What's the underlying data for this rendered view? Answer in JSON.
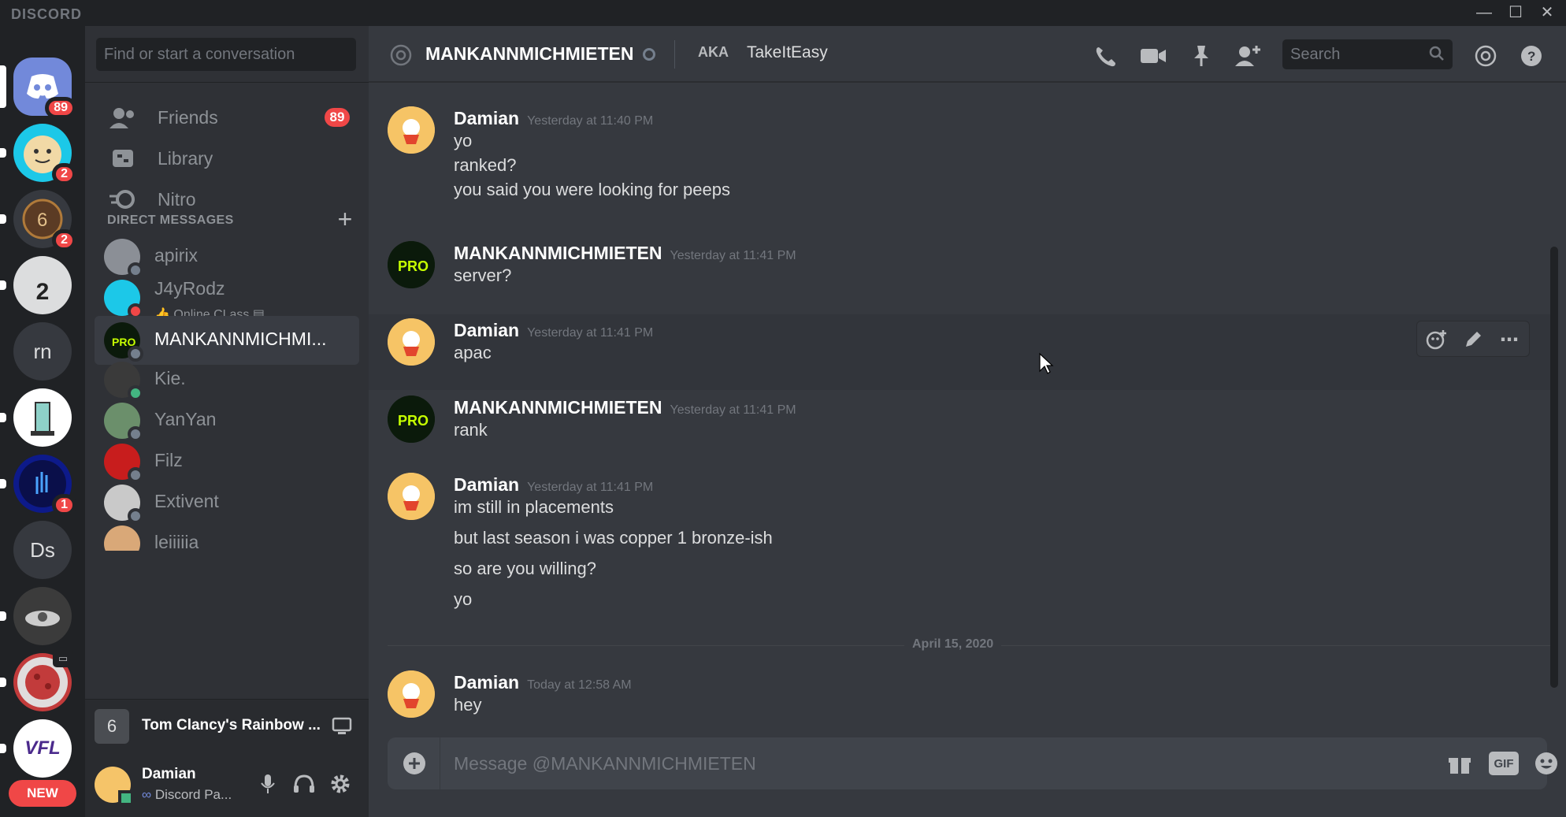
{
  "app": {
    "brand": "DISCORD",
    "window_controls": {
      "minimize": "—",
      "maximize": "☐",
      "close": "✕"
    }
  },
  "servers": [
    {
      "name": "home",
      "badge": "89",
      "color": "#7289da"
    },
    {
      "name": "server-smiley",
      "badge": "2",
      "color": "#1cc8e8"
    },
    {
      "name": "server-rainbow",
      "badge": "2",
      "color": "#5b3b24"
    },
    {
      "name": "server-y2",
      "label": "2",
      "color": "#dcddde"
    },
    {
      "name": "server-rn",
      "label": "rn",
      "color": "#36393f"
    },
    {
      "name": "server-cartoon",
      "color": "#ffffff"
    },
    {
      "name": "server-blue",
      "badge": "1",
      "color": "#0d1a8a"
    },
    {
      "name": "server-ds",
      "label": "Ds",
      "color": "#36393f"
    },
    {
      "name": "server-car",
      "color": "#3b3b3b"
    },
    {
      "name": "server-virus",
      "color": "#c23b3b"
    },
    {
      "name": "server-vfl",
      "label": "VFL",
      "color": "#4b2a8c"
    }
  ],
  "rail_new": "NEW",
  "sidebar": {
    "search_placeholder": "Find or start a conversation",
    "nav": [
      {
        "label": "Friends",
        "badge": "89"
      },
      {
        "label": "Library"
      },
      {
        "label": "Nitro"
      }
    ],
    "dm_header": "DIRECT MESSAGES",
    "dm_plus": "+",
    "dms": [
      {
        "name": "apirix",
        "status": "offline"
      },
      {
        "name": "J4yRodz",
        "status": "dnd",
        "activity": "Online CLass"
      },
      {
        "name": "MANKANNMICHMI...",
        "status": "offline",
        "active": true
      },
      {
        "name": "Kie.",
        "status": "online"
      },
      {
        "name": "YanYan",
        "status": "offline"
      },
      {
        "name": "Filz",
        "status": "offline"
      },
      {
        "name": "Extivent",
        "status": "offline"
      },
      {
        "name": "leiiiiia",
        "status": "offline"
      }
    ],
    "activity_game": "Tom Clancy's Rainbow ...",
    "user": {
      "name": "Damian",
      "status": "Discord Pa..."
    }
  },
  "chat": {
    "header": {
      "name": "MANKANNMICHMIETEN",
      "aka_label": "AKA",
      "nickname": "TakeItEasy",
      "search_placeholder": "Search"
    },
    "messages": [
      {
        "author": "Damian",
        "time": "Yesterday at 11:40 PM",
        "lines": [
          "yo",
          "ranked?",
          "you said you were looking for peeps"
        ]
      },
      {
        "author": "MANKANNMICHMIETEN",
        "time": "Yesterday at 11:41 PM",
        "lines": [
          "server?"
        ]
      },
      {
        "author": "Damian",
        "time": "Yesterday at 11:41 PM",
        "lines": [
          "apac"
        ]
      },
      {
        "author": "MANKANNMICHMIETEN",
        "time": "Yesterday at 11:41 PM",
        "lines": [
          "rank"
        ]
      },
      {
        "author": "Damian",
        "time": "Yesterday at 11:41 PM",
        "lines": [
          "im still in placements",
          "but last season i was copper 1 bronze-ish",
          "so are you willing?",
          "yo"
        ]
      },
      {
        "author": "Damian",
        "time": "Today at 12:58 AM",
        "lines": [
          "hey"
        ]
      }
    ],
    "date_divider": "April 15, 2020",
    "composer_placeholder": "Message @MANKANNMICHMIETEN",
    "composer_gif": "GIF"
  }
}
